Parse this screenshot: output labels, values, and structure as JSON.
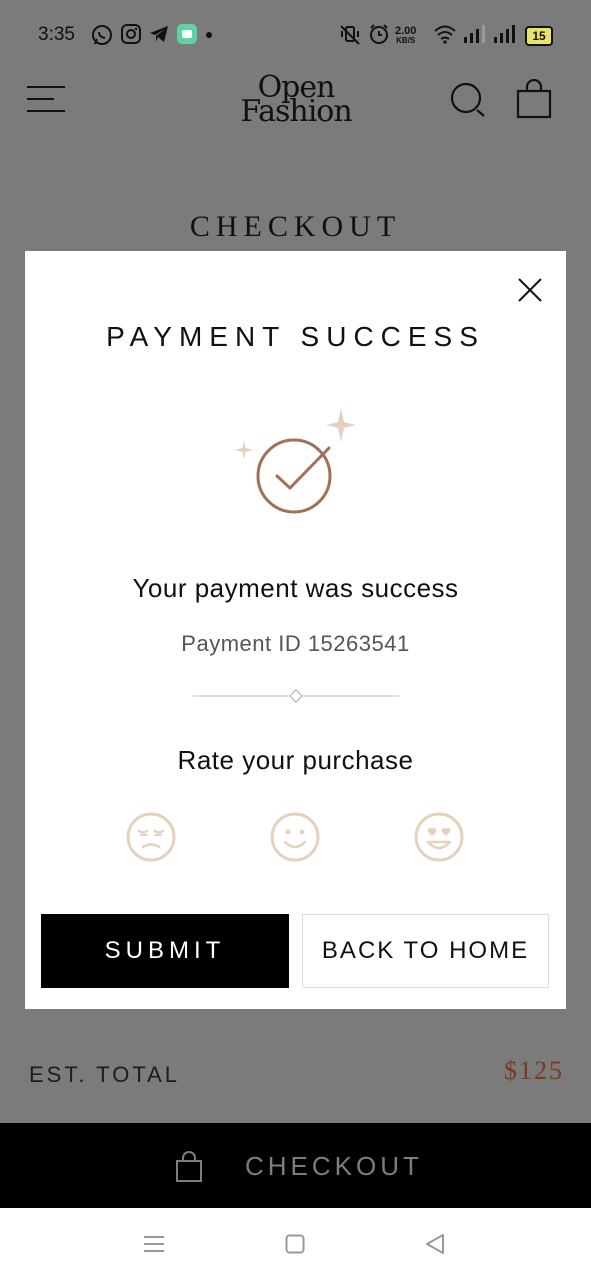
{
  "status_bar": {
    "time": "3:35",
    "speed_value": "2.00",
    "speed_unit": "KB/S",
    "battery": "15"
  },
  "header": {
    "logo_line1": "Open",
    "logo_line2": "Fashion"
  },
  "page": {
    "title": "CHECKOUT"
  },
  "modal": {
    "title": "PAYMENT SUCCESS",
    "message": "Your payment was success",
    "payment_id": "Payment ID 15263541",
    "rate_label": "Rate your purchase",
    "submit_label": "SUBMIT",
    "home_label": "BACK TO HOME"
  },
  "summary": {
    "est_total_label": "EST. TOTAL",
    "est_total_value": "$125"
  },
  "checkout_bar": {
    "label": "CHECKOUT"
  },
  "colors": {
    "accent": "#a0705a",
    "sparkle": "#e2d2be",
    "face": "#e2d2be",
    "price": "#7a3a22"
  }
}
